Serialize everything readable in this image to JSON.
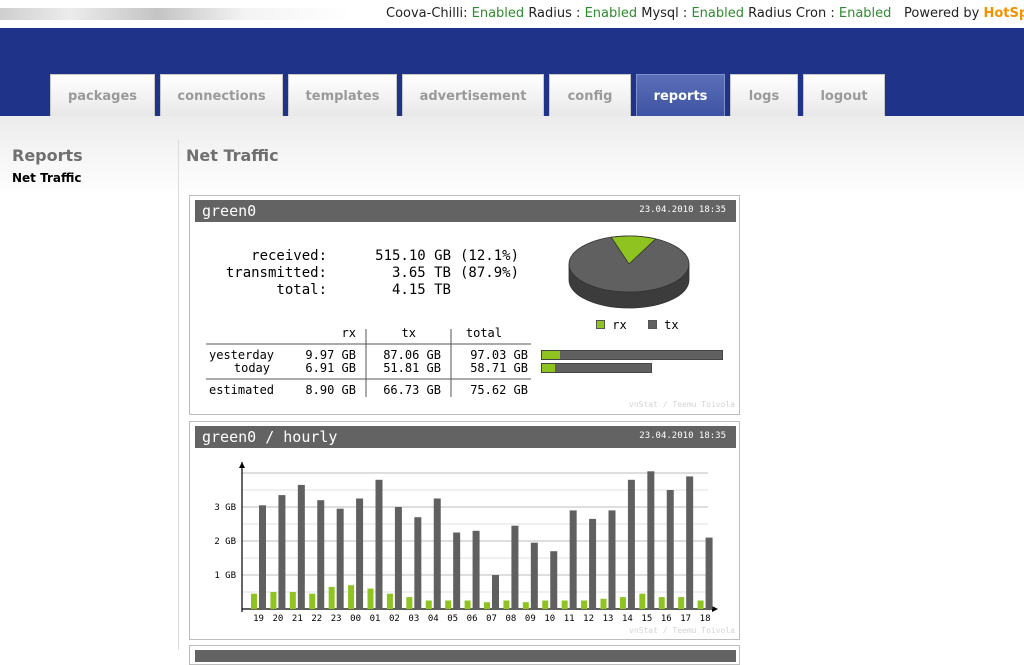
{
  "statusbar": {
    "coova_label": "Coova-Chilli:",
    "coova_status": "Enabled",
    "radius_label": "Radius :",
    "radius_status": "Enabled",
    "mysql_label": "Mysql :",
    "mysql_status": "Enabled",
    "radius_cron_label": "Radius Cron :",
    "radius_cron_status": "Enabled",
    "powered_label": "Powered by",
    "powered_brand": "HotSp",
    "ok_color": "#2e8b2e",
    "brand_color": "#f39200"
  },
  "nav": {
    "tabs": [
      {
        "label": "packages"
      },
      {
        "label": "connections"
      },
      {
        "label": "templates"
      },
      {
        "label": "advertisement"
      },
      {
        "label": "config"
      },
      {
        "label": "reports",
        "active": true
      },
      {
        "label": "logs"
      },
      {
        "label": "logout"
      }
    ],
    "bar_color": "#1f3489"
  },
  "sidebar": {
    "title": "Reports",
    "items": [
      {
        "label": "Net Traffic"
      }
    ]
  },
  "main": {
    "title": "Net Traffic"
  },
  "summary": {
    "header": "green0",
    "date": "23.04.2010 18:35",
    "received_label": "received:",
    "received_value": "515.10 GB",
    "received_pct": "(12.1%)",
    "transmitted_label": "transmitted:",
    "transmitted_value": "3.65 TB",
    "transmitted_pct": "(87.9%)",
    "total_label": "total:",
    "total_value": "4.15 TB",
    "columns": [
      "rx",
      "tx",
      "total"
    ],
    "rows": [
      {
        "label": "yesterday",
        "rx": "9.97 GB",
        "tx": "87.06 GB",
        "total": "97.03 GB",
        "bar_fraction": 1.0,
        "rx_share": 0.103
      },
      {
        "label": "today",
        "rx": "6.91 GB",
        "tx": "51.81 GB",
        "total": "58.71 GB",
        "bar_fraction": 0.605,
        "rx_share": 0.118
      }
    ],
    "estimated": {
      "label": "estimated",
      "rx": "8.90 GB",
      "tx": "66.73 GB",
      "total": "75.62 GB"
    },
    "legend": [
      {
        "name": "rx",
        "color": "#8fc31f"
      },
      {
        "name": "tx",
        "color": "#606060"
      }
    ],
    "pie": {
      "rx_pct": 12.1,
      "tx_pct": 87.9
    },
    "watermark": "vnStat / Teemu Toivola"
  },
  "hourly": {
    "header": "green0 / hourly",
    "date": "23.04.2010 18:35",
    "watermark": "vnStat / Teemu Toivola",
    "chart_data": {
      "type": "bar",
      "categories": [
        "19",
        "20",
        "21",
        "22",
        "23",
        "00",
        "01",
        "02",
        "03",
        "04",
        "05",
        "06",
        "07",
        "08",
        "09",
        "10",
        "11",
        "12",
        "13",
        "14",
        "15",
        "16",
        "17",
        "18"
      ],
      "series": [
        {
          "name": "rx",
          "values": [
            0.45,
            0.5,
            0.5,
            0.45,
            0.65,
            0.7,
            0.6,
            0.45,
            0.35,
            0.25,
            0.25,
            0.25,
            0.2,
            0.25,
            0.2,
            0.25,
            0.25,
            0.25,
            0.3,
            0.35,
            0.45,
            0.35,
            0.35,
            0.25
          ]
        },
        {
          "name": "tx",
          "values": [
            3.05,
            3.35,
            3.65,
            3.2,
            2.95,
            3.25,
            3.8,
            3.0,
            2.7,
            3.25,
            2.25,
            2.3,
            1.0,
            2.45,
            1.95,
            1.7,
            2.9,
            2.65,
            2.9,
            3.8,
            4.05,
            3.5,
            3.9,
            2.1
          ]
        }
      ],
      "ytick_labels": [
        "1 GB",
        "2 GB",
        "3 GB"
      ],
      "ylim": [
        0,
        4.3
      ],
      "colors": {
        "rx": "#8fc31f",
        "tx": "#606060"
      },
      "grid": true
    }
  }
}
